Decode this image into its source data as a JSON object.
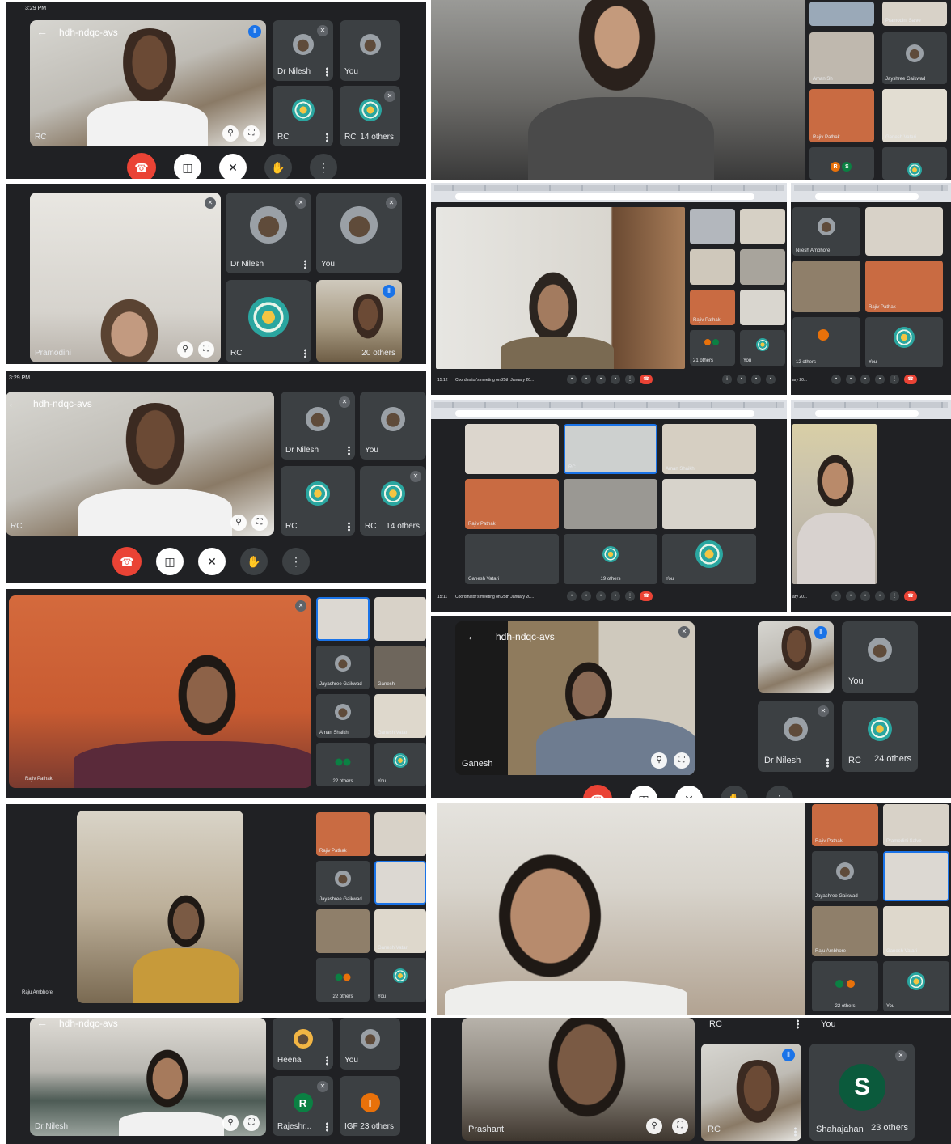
{
  "status_times": [
    "3:29 PM",
    "3:29 PM"
  ],
  "panel_a": {
    "room": "hdh-ndqc-avs",
    "main_label": "RC",
    "tiles": [
      {
        "name": "Dr Nilesh"
      },
      {
        "name": "You"
      },
      {
        "name": "RC"
      },
      {
        "name": "RC",
        "others": "14 others"
      }
    ]
  },
  "panel_b": {
    "thumbs": [
      {
        "name": ""
      },
      {
        "name": "Pramodini Salve"
      },
      {
        "name": "Aman Sh"
      },
      {
        "name": "Jayshree Gaikwad"
      },
      {
        "name": "Rajiv Pathak"
      },
      {
        "name": "Ganesh Vatari"
      }
    ],
    "others_initials": [
      "R",
      "S"
    ]
  },
  "panel_c": {
    "main_label": "Pramodini",
    "tiles": [
      {
        "name": "Dr Nilesh"
      },
      {
        "name": "You"
      },
      {
        "name": "RC"
      },
      {
        "name": "",
        "others": "20 others"
      }
    ]
  },
  "panel_d": {
    "caption": "Coordinator's meeting on 25th January 20...",
    "time": "15:12",
    "others_label": "21 others",
    "you_label": "You",
    "thumb_names": [
      "",
      "",
      "",
      "",
      "Rajiv Pathak",
      ""
    ]
  },
  "panel_e": {
    "time": "ary 20...",
    "others_label": "12 others",
    "you_label": "You",
    "thumb_names": [
      "Nilesh Ambhore",
      "",
      "",
      "Rajiv Pathak"
    ]
  },
  "panel_f": {
    "room": "hdh-ndqc-avs",
    "main_label": "RC",
    "tiles": [
      {
        "name": "Dr Nilesh"
      },
      {
        "name": "You"
      },
      {
        "name": "RC"
      },
      {
        "name": "RC",
        "others": "14 others"
      }
    ]
  },
  "panel_g": {
    "caption": "Coordinator's meeting on 25th January 20...",
    "time": "15:11",
    "names": [
      "",
      "RC",
      "Aman Shaikh",
      "Rajiv Pathak",
      "",
      "",
      "Ganesh Vatari",
      "19 others",
      "You"
    ]
  },
  "panel_h": {
    "time": "ary 20..."
  },
  "panel_i": {
    "main_label": "Rajiv Pathak",
    "names": [
      "",
      "",
      "Jayashree Gaikwad",
      "Ganesh",
      "Aman Shaikh",
      "Ganesh Vatari",
      "22 others",
      "You"
    ]
  },
  "panel_j": {
    "room": "hdh-ndqc-avs",
    "main_label": "Ganesh",
    "tiles": [
      {
        "name": ""
      },
      {
        "name": "You"
      },
      {
        "name": "Dr Nilesh"
      },
      {
        "name": "RC",
        "others": "24 others"
      }
    ]
  },
  "panel_k": {
    "main_label": "Raju Ambhore",
    "names": [
      "Rajiv Pathak",
      "",
      "Jayashree Gaikwad",
      "",
      "",
      "Ganesh Vatari",
      "22 others",
      "You"
    ]
  },
  "panel_l": {
    "names": [
      "Rajiv Pathak",
      "Pramodini Salve",
      "Jayashree Gaikwad",
      "",
      "Raju Ambhore",
      "Ganesh Vatari",
      "22 others",
      "You"
    ]
  },
  "panel_m": {
    "room": "hdh-ndqc-avs",
    "main_label": "Dr Nilesh",
    "tiles": [
      {
        "name": "Heena"
      },
      {
        "name": "You"
      },
      {
        "name": "Rajeshr...",
        "initial": "R"
      },
      {
        "name": "IGF",
        "initial": "I",
        "others": "23 others"
      }
    ]
  },
  "panel_n": {
    "main_label": "Prashant",
    "top_labels": [
      "RC",
      "You"
    ],
    "tiles": [
      {
        "name": "RC"
      },
      {
        "name": "Shahajahan",
        "initial": "S",
        "others": "23 others"
      }
    ]
  },
  "colors": {
    "meet_bg": "#202124",
    "tile_bg": "#3c4043",
    "hangup_red": "#ea4335",
    "speaking_blue": "#1a73e8",
    "avatar_green": "#0b8043",
    "avatar_orange": "#e8710a"
  }
}
